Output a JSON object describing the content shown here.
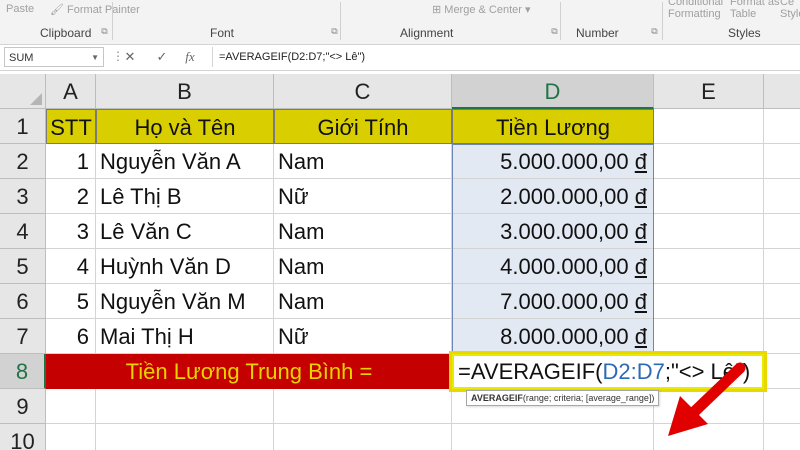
{
  "ribbon": {
    "paste_label": "Paste",
    "format_painter_label": "Format Painter",
    "merge_center_label": "Merge & Center",
    "conditional_label": "Conditional",
    "conditional_sub": "Formatting",
    "format_as_label": "Format as",
    "format_as_sub": "Table",
    "cell_label": "Ce",
    "cell_sub": "Style",
    "groups": {
      "clipboard": "Clipboard",
      "font": "Font",
      "alignment": "Alignment",
      "number": "Number",
      "styles": "Styles"
    }
  },
  "formula_bar": {
    "name_box": "SUM",
    "cancel_icon": "✕",
    "enter_icon": "✓",
    "fx_label": "fx",
    "formula": "=AVERAGEIF(D2:D7;\"<> Lê\")"
  },
  "columns": [
    "A",
    "B",
    "C",
    "D",
    "E"
  ],
  "rows": [
    "1",
    "2",
    "3",
    "4",
    "5",
    "6",
    "7",
    "8",
    "9",
    "10"
  ],
  "table": {
    "headers": [
      "STT",
      "Họ và Tên",
      "Giới Tính",
      "Tiền Lương"
    ],
    "data": [
      {
        "stt": "1",
        "name": "Nguyễn Văn A",
        "gender": "Nam",
        "salary": "5.000.000,00",
        "currency": "đ"
      },
      {
        "stt": "2",
        "name": "Lê Thị B",
        "gender": "Nữ",
        "salary": "2.000.000,00",
        "currency": "đ"
      },
      {
        "stt": "3",
        "name": "Lê Văn C",
        "gender": "Nam",
        "salary": "3.000.000,00",
        "currency": "đ"
      },
      {
        "stt": "4",
        "name": "Huỳnh Văn D",
        "gender": "Nam",
        "salary": "4.000.000,00",
        "currency": "đ"
      },
      {
        "stt": "5",
        "name": "Nguyễn Văn M",
        "gender": "Nam",
        "salary": "7.000.000,00",
        "currency": "đ"
      },
      {
        "stt": "6",
        "name": "Mai Thị H",
        "gender": "Nữ",
        "salary": "8.000.000,00",
        "currency": "đ"
      }
    ],
    "summary_label": "Tiền Lương Trung Bình ="
  },
  "active_cell": {
    "prefix": "=AVERAGEIF(",
    "ref": "D2:D7",
    "suffix": ";\"<> Lê\")"
  },
  "tooltip": {
    "fn": "AVERAGEIF",
    "args": "(range; criteria; [average_range])"
  },
  "colors": {
    "header_fill": "#d9cf00",
    "summary_fill": "#c40000",
    "summary_text": "#e8d300",
    "active_border": "#e8d800",
    "reference_blue": "#2d6ab5",
    "arrow_red": "#e00000",
    "excel_green": "#217346"
  },
  "icons": {
    "annotation": "red-arrow-icon"
  }
}
